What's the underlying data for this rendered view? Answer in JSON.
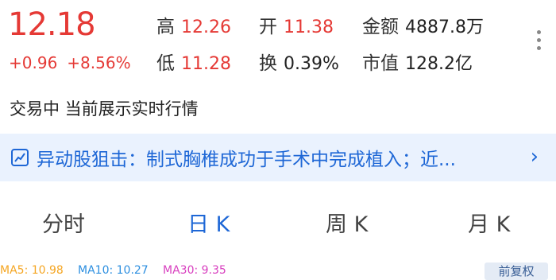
{
  "quote": {
    "price": "12.18",
    "change": "+0.96",
    "change_pct": "+8.56%",
    "high_label": "高",
    "high": "12.26",
    "low_label": "低",
    "low": "11.28",
    "open_label": "开",
    "open": "11.38",
    "turnover_label": "换",
    "turnover": "0.39%",
    "amount_label": "金额",
    "amount": "4887.8万",
    "mktcap_label": "市值",
    "mktcap": "128.2亿"
  },
  "status_text": "交易中 当前展示实时行情",
  "banner": {
    "text": "异动股狙击：制式胸椎成功于手术中完成植入；近..."
  },
  "tabs": [
    {
      "label": "分时",
      "active": false
    },
    {
      "label": "日 K",
      "active": true
    },
    {
      "label": "周 K",
      "active": false
    },
    {
      "label": "月 K",
      "active": false
    }
  ],
  "ma": {
    "ma5": "MA5: 10.98",
    "ma10": "MA10: 10.27",
    "ma30": "MA30: 9.35"
  },
  "adjust_label": "前复权",
  "colors": {
    "up": "#e53935",
    "accent": "#1e67d6",
    "ma5": "#f5a623",
    "ma10": "#2d8fe0",
    "ma30": "#d83fbf"
  }
}
